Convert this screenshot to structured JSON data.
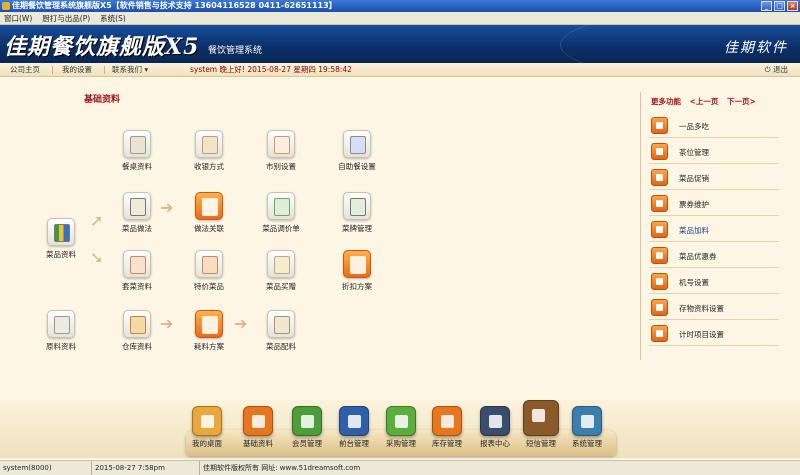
{
  "window": {
    "title": "佳期餐饮管理系统旗舰版X5【软件销售与技术支持 13604116528  0411-62651113】",
    "controls": [
      "_",
      "□",
      "×"
    ]
  },
  "menubar": [
    "窗口(W)",
    "厨打与出品(P)",
    "系统(S)"
  ],
  "banner": {
    "logo": "佳期餐饮旗舰版X5",
    "subtitle": "餐饮管理系统",
    "brand": "佳期软件"
  },
  "navbar": {
    "home": "公司主页",
    "settings": "我的设置",
    "contact": "联系我们 ▾",
    "status": "system 晚上好! 2015-08-27 星期四 19:58:42",
    "logout": "退出"
  },
  "main": {
    "section_title": "基础资料",
    "nodes": {
      "menu_data": "菜品资料",
      "table_data": "餐桌资料",
      "payment": "收银方式",
      "market": "市别设置",
      "self_order": "自助餐设置",
      "cooking": "菜品做法",
      "cooking_link": "做法关联",
      "price_adjust": "菜品调价单",
      "coupon_mgmt": "菜牌管理",
      "set_menu": "套菜资料",
      "special": "特价菜品",
      "buy_gift": "菜品买赠",
      "discount": "折扣方案",
      "raw_data": "原料资料",
      "warehouse": "仓库资料",
      "consume_plan": "耗料方案",
      "ingredients": "菜品配料"
    }
  },
  "sidebar": {
    "title": "更多功能",
    "prev": "<上一页",
    "next": "下一页>",
    "items": [
      {
        "label": "一品多吃"
      },
      {
        "label": "茶位管理"
      },
      {
        "label": "菜品促销"
      },
      {
        "label": "票券维护"
      },
      {
        "label": "菜品加料"
      },
      {
        "label": "菜品优惠券"
      },
      {
        "label": "机号设置"
      },
      {
        "label": "存物资料设置"
      },
      {
        "label": "计时项目设置"
      }
    ]
  },
  "dock": [
    {
      "label": "我的桌面",
      "color": "#e9a83c"
    },
    {
      "label": "基础资料",
      "color": "#e8761f"
    },
    {
      "label": "会员管理",
      "color": "#4c9e3a"
    },
    {
      "label": "前台管理",
      "color": "#2f5fa8"
    },
    {
      "label": "采购管理",
      "color": "#5aae3c"
    },
    {
      "label": "库存管理",
      "color": "#e8761f"
    },
    {
      "label": "报表中心",
      "color": "#3a4d6a"
    },
    {
      "label": "短信管理",
      "color": "#8a5a2a"
    },
    {
      "label": "系统管理",
      "color": "#3b7fb0"
    }
  ],
  "statusbar": {
    "user": "system(8000)",
    "datetime": "2015-08-27 7:58pm",
    "copyright": "佳期软件版权所有 网址: www.51dreamsoft.com"
  }
}
